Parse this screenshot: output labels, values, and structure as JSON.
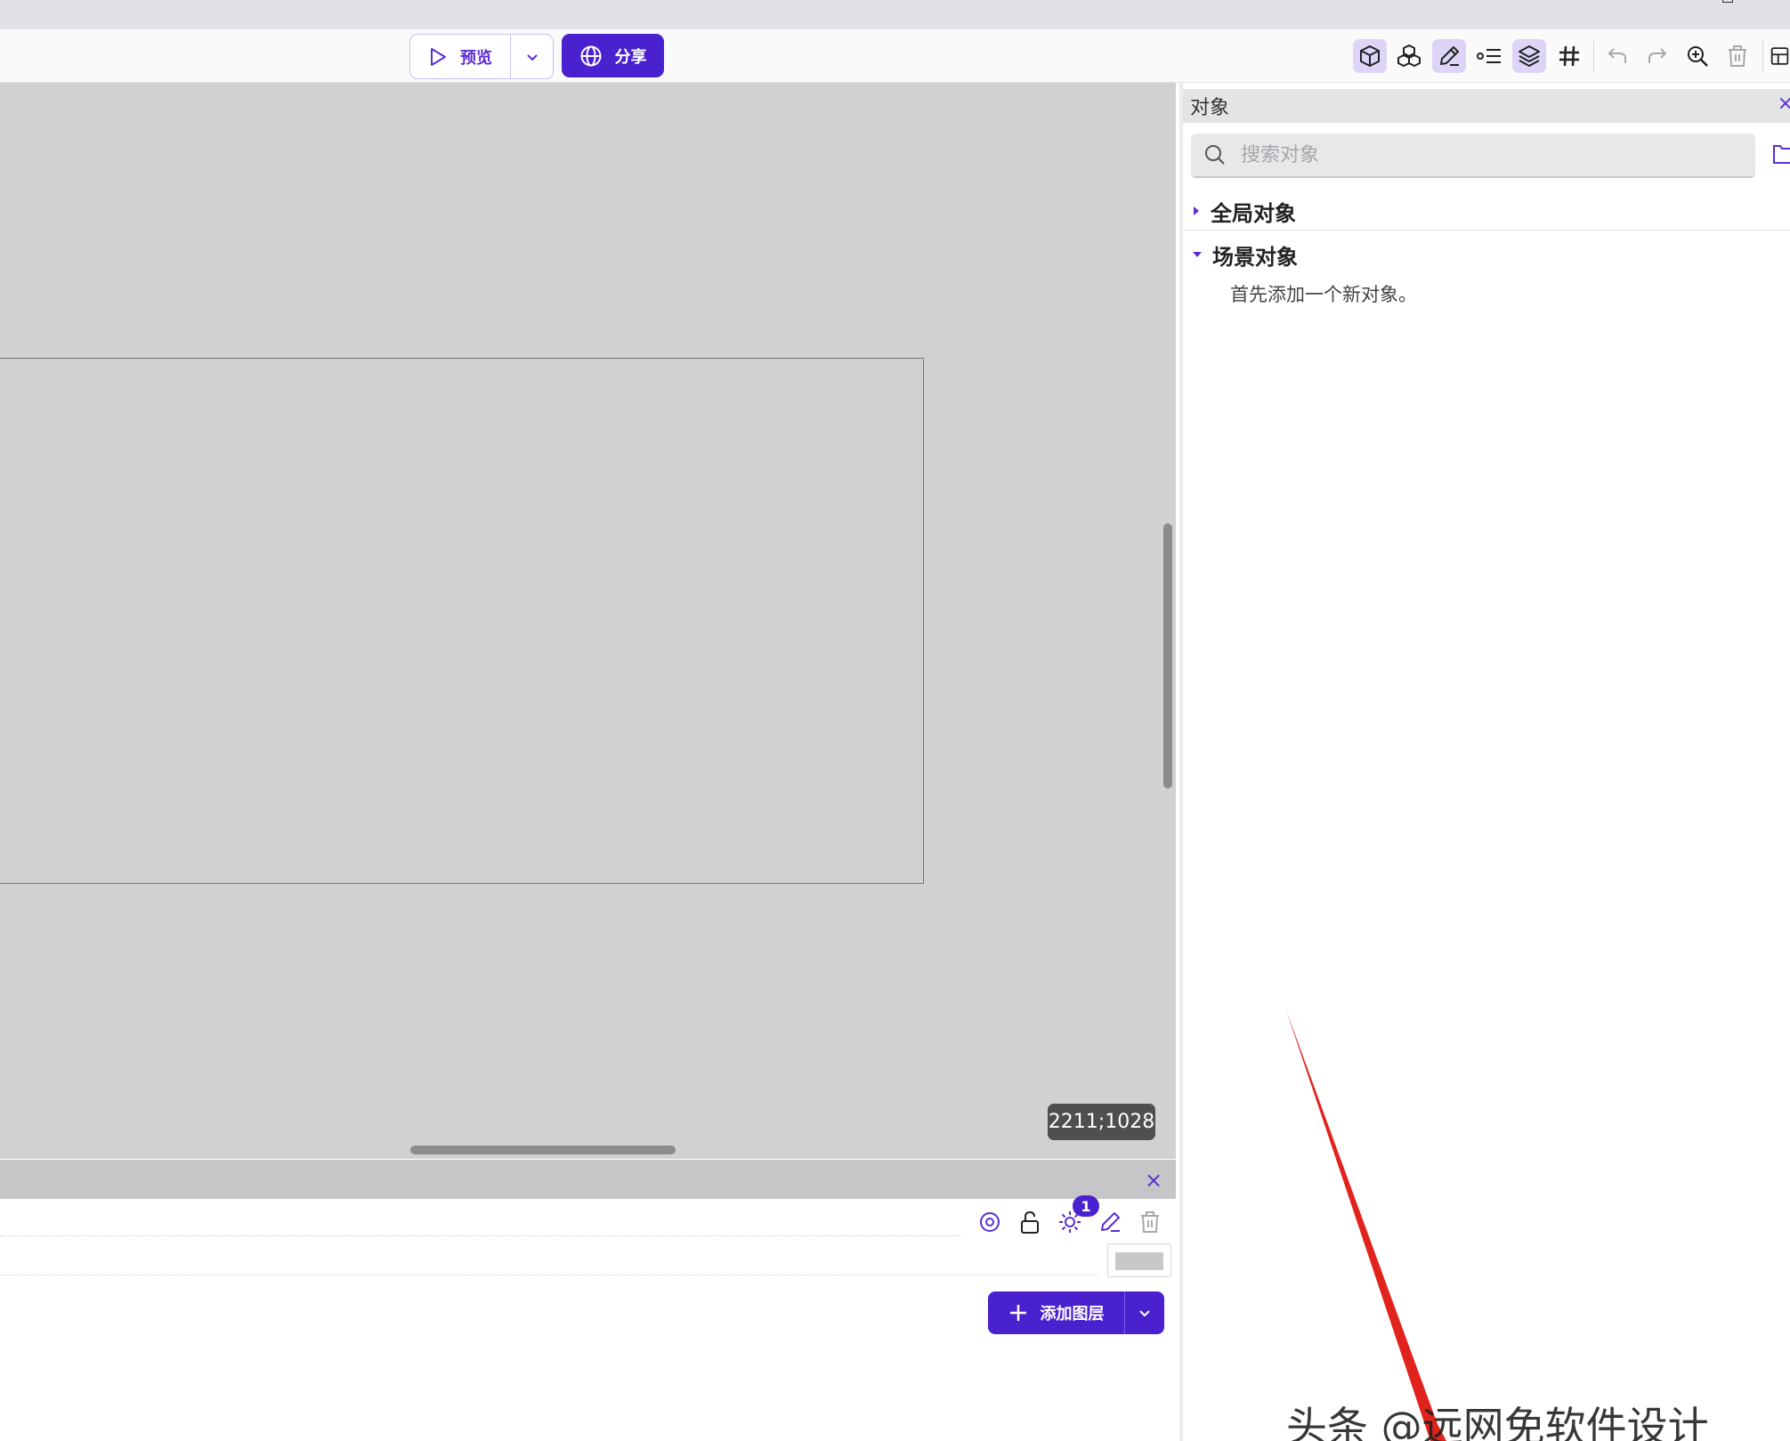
{
  "toolbar": {
    "preview_label": "预览",
    "share_label": "分享",
    "tools": [
      {
        "icon": "cube-icon",
        "active": true
      },
      {
        "icon": "cubes-icon",
        "active": false
      },
      {
        "icon": "pencil-icon",
        "active": true
      },
      {
        "icon": "properties-list-icon",
        "active": false
      },
      {
        "icon": "layers-icon",
        "active": true
      },
      {
        "icon": "grid-icon",
        "active": false
      },
      {
        "icon": "undo-icon",
        "active": false
      },
      {
        "icon": "redo-icon",
        "active": false
      },
      {
        "icon": "zoom-icon",
        "active": false
      },
      {
        "icon": "trash-icon",
        "active": false
      }
    ]
  },
  "canvas": {
    "coordinates": "2211;1028"
  },
  "objects_panel": {
    "title": "对象",
    "search_placeholder": "搜索对象",
    "global_objects_label": "全局对象",
    "scene_objects_label": "场景对象",
    "empty_hint": "首先添加一个新对象。"
  },
  "layers_panel": {
    "lights_badge": "1",
    "add_layer_label": "添加图层"
  },
  "watermark": {
    "text": "头条 @远网免软件设计"
  },
  "colors": {
    "accent": "#4a21cf",
    "accent_light": "#ddd4f8",
    "canvas_bg": "#d1d1d2",
    "annotation_arrow": "#e0231c"
  }
}
